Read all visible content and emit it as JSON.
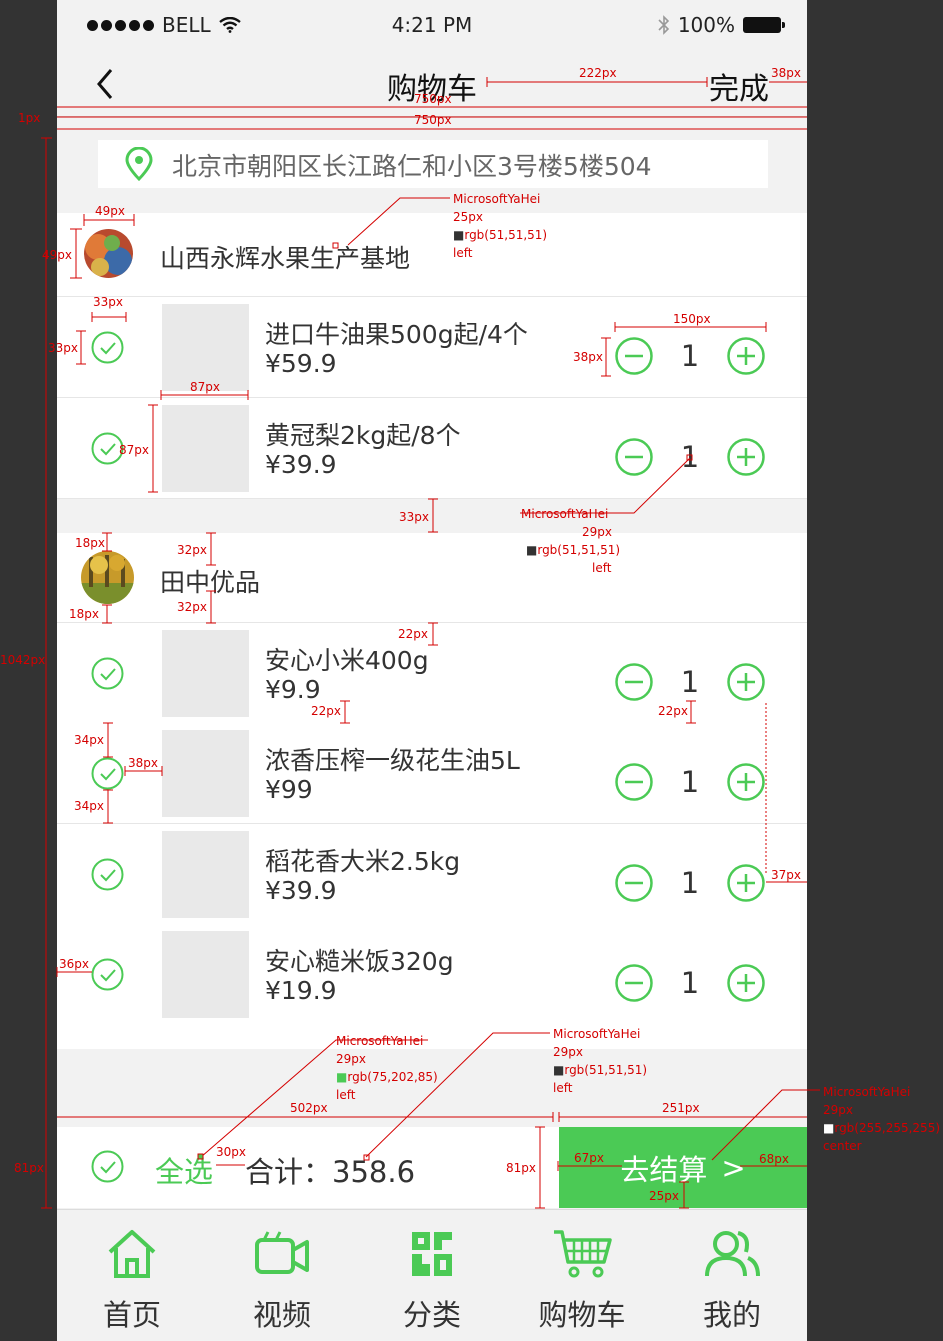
{
  "status": {
    "carrier": "BELL",
    "time": "4:21 PM",
    "battery": "100%"
  },
  "nav": {
    "title": "购物车",
    "done": "完成"
  },
  "address": {
    "text": "北京市朝阳区长江路仁和小区3号楼5楼504"
  },
  "stores": [
    {
      "name": "山西永辉水果生产基地",
      "items": [
        {
          "name": "进口牛油果500g起/4个",
          "price": "¥59.9",
          "qty": "1"
        },
        {
          "name": "黄冠梨2kg起/8个",
          "price": "¥39.9",
          "qty": "1"
        }
      ]
    },
    {
      "name": "田中优品",
      "items": [
        {
          "name": "安心小米400g",
          "price": "¥9.9",
          "qty": "1"
        },
        {
          "name": "浓香压榨一级花生油5L",
          "price": "¥99",
          "qty": "1"
        },
        {
          "name": "稻花香大米2.5kg",
          "price": "¥39.9",
          "qty": "1"
        },
        {
          "name": "安心糙米饭320g",
          "price": "¥19.9",
          "qty": "1"
        }
      ]
    }
  ],
  "bottom_bar": {
    "select_all": "全选",
    "total": "合计：358.6",
    "checkout": "去结算",
    "checkout_arrow": ">"
  },
  "tabs": [
    {
      "label": "首页",
      "icon": "home-icon"
    },
    {
      "label": "视频",
      "icon": "video-icon"
    },
    {
      "label": "分类",
      "icon": "category-icon"
    },
    {
      "label": "购物车",
      "icon": "cart-icon"
    },
    {
      "label": "我的",
      "icon": "user-icon"
    }
  ],
  "colors": {
    "accent": "#4bca55",
    "text": "#333333",
    "annotation": "#d40000"
  },
  "annotations": {
    "w222": "222px",
    "w38": "38px",
    "w750a": "750px",
    "w750b": "750px",
    "h1": "1px",
    "w49": "49px",
    "h49": "49px",
    "font1": "MicrosoftYaHei",
    "size1": "25px",
    "color1": "rgb(51,51,51)",
    "align1": "left",
    "w33": "33px",
    "h33": "33px",
    "w150": "150px",
    "h38": "38px",
    "w87": "87px",
    "h87": "87px",
    "gap33": "33px",
    "font2": "MicrosoftYaHei",
    "size2": "29px",
    "color2": "rgb(51,51,51)",
    "align2": "left",
    "h18a": "18px",
    "h32a": "32px",
    "h32b": "32px",
    "h18b": "18px",
    "h22a": "22px",
    "h22b": "22px",
    "h22c": "22px",
    "h34a": "34px",
    "w38b": "38px",
    "h34b": "34px",
    "w37": "37px",
    "w36": "36px",
    "h1042": "1042px",
    "font3": "MicrosoftYaHei",
    "size3": "29px",
    "color3": "rgb(75,202,85)",
    "align3": "left",
    "font4": "MicrosoftYaHei",
    "size4": "29px",
    "color4": "rgb(51,51,51)",
    "align4": "left",
    "font5": "MicrosoftYaHei",
    "size5": "29px",
    "color5": "rgb(255,255,255)",
    "align5": "center",
    "w502": "502px",
    "w251": "251px",
    "w30": "30px",
    "w67": "67px",
    "w68": "68px",
    "h25": "25px",
    "h81a": "81px",
    "h81b": "81px"
  }
}
